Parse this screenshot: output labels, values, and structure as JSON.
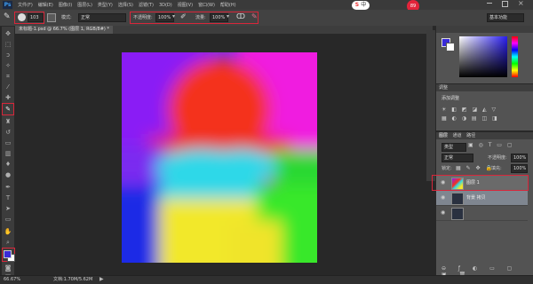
{
  "app": {
    "logo": "Ps"
  },
  "menu": [
    "文件(F)",
    "编辑(E)",
    "图像(I)",
    "图层(L)",
    "类型(Y)",
    "选择(S)",
    "滤镜(T)",
    "3D(D)",
    "视图(V)",
    "窗口(W)",
    "帮助(H)"
  ],
  "ime": {
    "logo": "S",
    "lang": "中",
    "badge": "89"
  },
  "options": {
    "brush_size": "103",
    "mode_label": "模式:",
    "mode_value": "正常",
    "opacity_label": "不透明度:",
    "opacity_value": "100%",
    "flow_label": "流量:",
    "flow_value": "100%"
  },
  "workspace": "基本功能",
  "document_tab": "未标题-1.psd @ 66.7% (图层 1, RGB/8#) *",
  "panels": {
    "adjust_title": "调整",
    "adjust_hint": "添加调整",
    "layers_tabs": [
      "图层",
      "通道",
      "路径"
    ],
    "filter_kind": "类型",
    "blend_mode": "正常",
    "opacity_label": "不透明度:",
    "opacity_value": "100%",
    "lock_label": "锁定:",
    "fill_label": "填充:",
    "fill_value": "100%",
    "layers": [
      {
        "name": "图层 1"
      },
      {
        "name": "背景 拷贝"
      },
      {
        "name": ""
      }
    ]
  },
  "status": {
    "zoom": "66.67%",
    "doc": "文档:1.70M/5.62M"
  },
  "colors": {
    "foreground": "#3a2bd9",
    "background": "#ffffff",
    "highlight": "#d8263a"
  }
}
